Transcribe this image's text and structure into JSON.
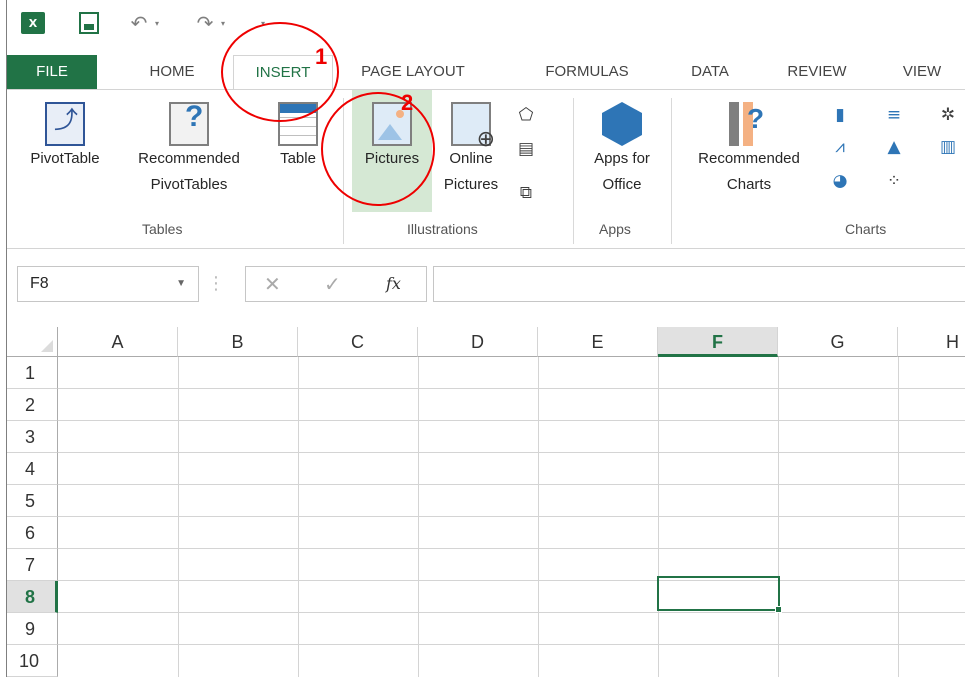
{
  "qat": {
    "icons": [
      "excel-logo-icon",
      "save-icon",
      "undo-icon",
      "redo-icon",
      "customize-dropdown-icon"
    ]
  },
  "tabs": [
    "FILE",
    "HOME",
    "INSERT",
    "PAGE LAYOUT",
    "FORMULAS",
    "DATA",
    "REVIEW",
    "VIEW"
  ],
  "ribbon": {
    "pivottable": "PivotTable",
    "recommended_pivot_1": "Recommended",
    "recommended_pivot_2": "PivotTables",
    "table": "Table",
    "tables_group": "Tables",
    "pictures": "Pictures",
    "online_pictures_1": "Online",
    "online_pictures_2": "Pictures",
    "illustrations_group": "Illustrations",
    "apps_for_office_1": "Apps for",
    "apps_for_office_2": "Office",
    "apps_group": "Apps",
    "recommended_charts_1": "Recommended",
    "recommended_charts_2": "Charts",
    "charts_group": "Charts"
  },
  "annotations": {
    "step1": "1",
    "step2": "2"
  },
  "formula_bar": {
    "name_box": "F8",
    "fx": "fx",
    "cancel": "✕",
    "enter": "✓",
    "content": ""
  },
  "grid": {
    "columns": [
      "A",
      "B",
      "C",
      "D",
      "E",
      "F",
      "G",
      "H"
    ],
    "rows": [
      "1",
      "2",
      "3",
      "4",
      "5",
      "6",
      "7",
      "8",
      "9",
      "10"
    ],
    "selected_column": "F",
    "selected_row": "8"
  },
  "colors": {
    "excel_green": "#217346",
    "annotation_red": "#e00000"
  }
}
